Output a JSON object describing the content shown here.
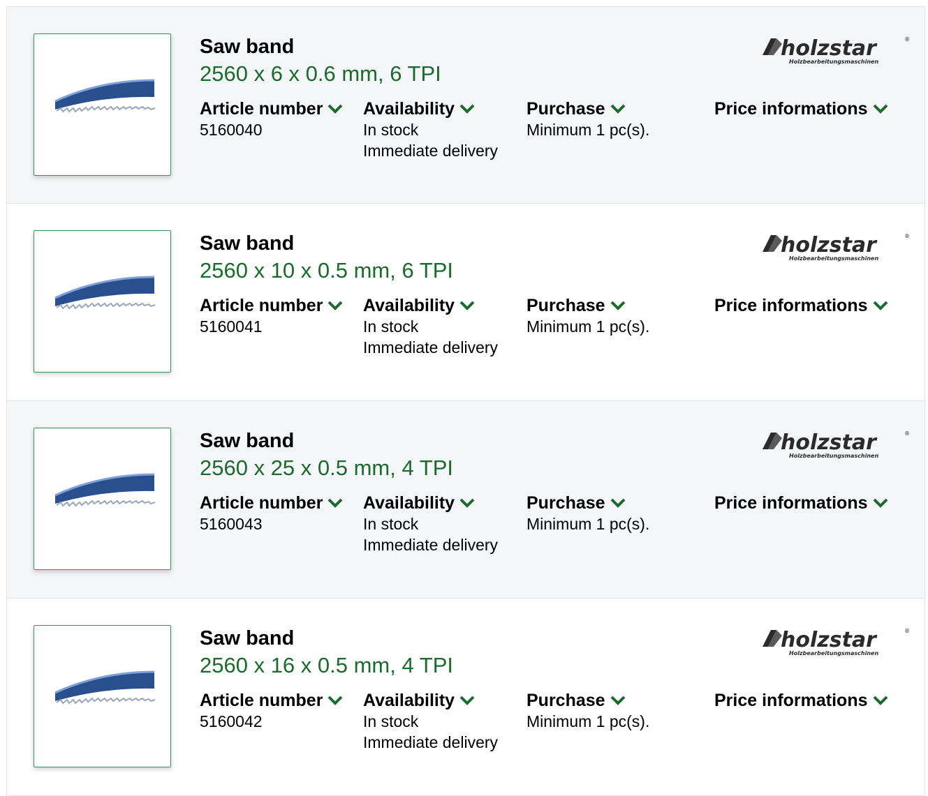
{
  "brand": {
    "name": "holzstar",
    "tagline": "Holzbearbeitungsmaschinen",
    "registered": "®"
  },
  "labels": {
    "article_number": "Article number",
    "availability": "Availability",
    "purchase": "Purchase",
    "price_informations": "Price informations"
  },
  "colors": {
    "accent_green": "#1b6b2d",
    "blade_blue": "#2a4f8f",
    "row_alt_bg": "#f4f6f9"
  },
  "products": [
    {
      "title": "Saw band",
      "spec": "2560 x 6 x 0.6 mm, 6 TPI",
      "article_number": "5160040",
      "stock": "In stock",
      "delivery": "Immediate delivery",
      "purchase": "Minimum 1 pc(s)."
    },
    {
      "title": "Saw band",
      "spec": "2560 x 10 x 0.5 mm, 6 TPI",
      "article_number": "5160041",
      "stock": "In stock",
      "delivery": "Immediate delivery",
      "purchase": "Minimum 1 pc(s)."
    },
    {
      "title": "Saw band",
      "spec": "2560 x 25 x 0.5 mm, 4 TPI",
      "article_number": "5160043",
      "stock": "In stock",
      "delivery": "Immediate delivery",
      "purchase": "Minimum 1 pc(s)."
    },
    {
      "title": "Saw band",
      "spec": "2560 x 16 x 0.5 mm, 4 TPI",
      "article_number": "5160042",
      "stock": "In stock",
      "delivery": "Immediate delivery",
      "purchase": "Minimum 1 pc(s)."
    }
  ]
}
